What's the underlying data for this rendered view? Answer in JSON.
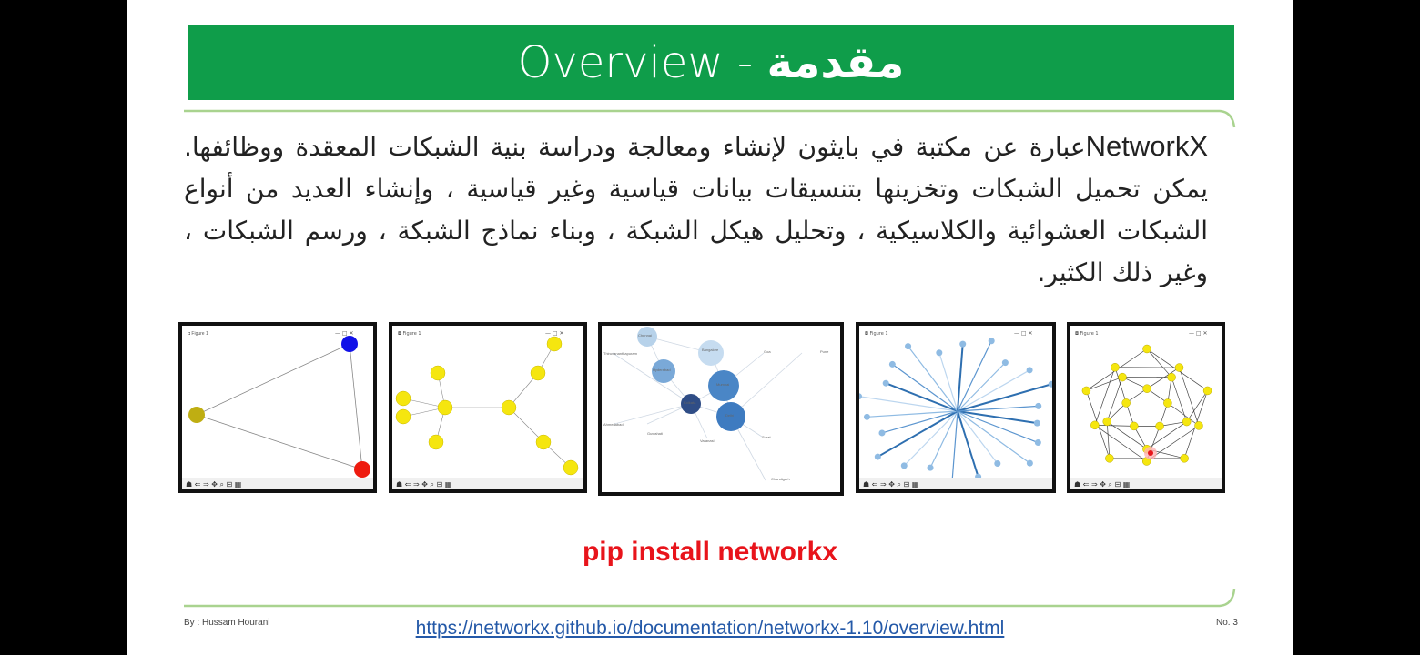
{
  "title": {
    "arabic": "مقدمة",
    "separator": " - ",
    "english": "Overview"
  },
  "paragraph": {
    "lead": "NetworkX",
    "text": "عبارة عن مكتبة في بايثون لإنشاء ومعالجة ودراسة بنية الشبكات المعقدة ووظائفها. يمكن تحميل الشبكات وتخزينها بتنسيقات بيانات قياسية وغير قياسية ، وإنشاء العديد من أنواع الشبكات العشوائية والكلاسيكية ، وتحليل هيكل الشبكة ، وبناء نماذج الشبكة ، ورسم الشبكات ، وغير ذلك الكثير."
  },
  "figures": [
    {
      "name": "triangle-graph"
    },
    {
      "name": "tree-graph"
    },
    {
      "name": "city-bubble-graph",
      "labels": [
        "Chennai",
        "Bangalore",
        "Hyderabad",
        "Mumbai",
        "Kolkata",
        "Delhi",
        "Varanasi",
        "Goa",
        "Pune",
        "Surat",
        "Chandigarh",
        "Guwahati",
        "Ahmedabad",
        "Thiruvananthapuram"
      ]
    },
    {
      "name": "star-graph"
    },
    {
      "name": "dodecahedral-graph"
    }
  ],
  "install_command": "pip install networkx",
  "footer": {
    "author": "By : Hussam Hourani",
    "url": "https://networkx.github.io/documentation/networkx-1.10/overview.html",
    "page": "No. 3"
  },
  "colors": {
    "title_bar": "#0f9d4a",
    "accent_line": "#a9d38f",
    "command": "#e8141b",
    "link": "#2459a8"
  }
}
